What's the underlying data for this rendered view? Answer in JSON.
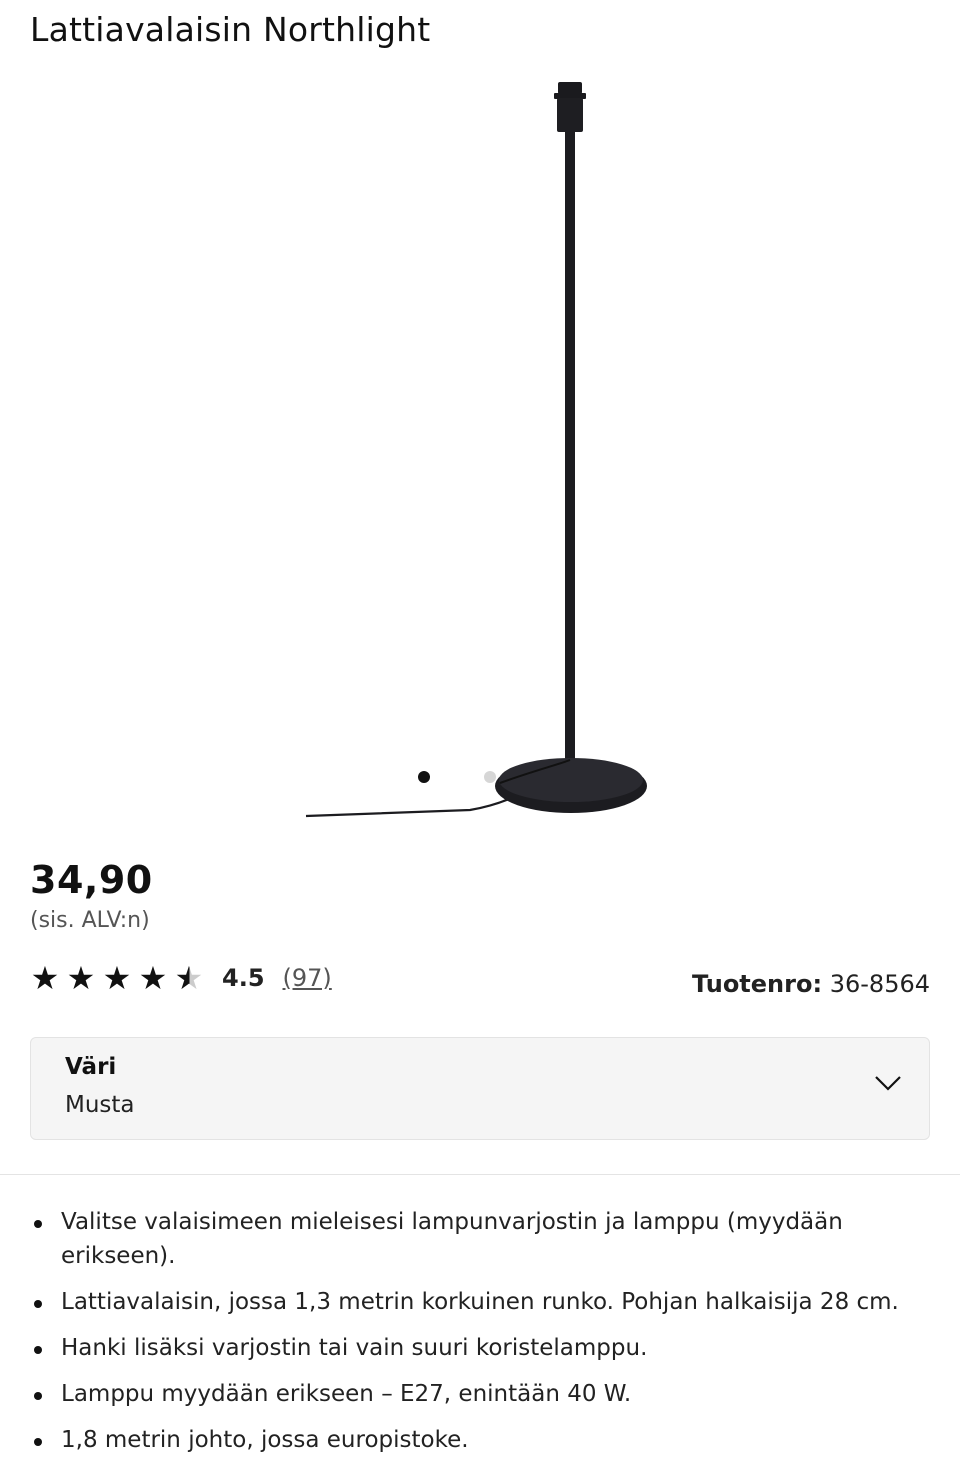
{
  "product": {
    "title": "Lattiavalaisin Northlight",
    "price": "34,90",
    "vat_note": "(sis. ALV:n)",
    "rating_value": "4.5",
    "rating_stars": 4.5,
    "review_count": "(97)",
    "article_label": "Tuotenro:",
    "article_number": "36-8564"
  },
  "gallery": {
    "image_alt": "floor-lamp-image",
    "total_images": 2,
    "active_index": 0
  },
  "color_select": {
    "label": "Väri",
    "value": "Musta"
  },
  "features": [
    "Valitse valaisimeen mieleisesi lampunvarjostin ja lamppu (myydään erikseen).",
    "Lattiavalaisin, jossa 1,3 metrin korkuinen runko. Pohjan halkaisija 28 cm.",
    "Hanki lisäksi varjostin tai vain suuri koristelamppu.",
    "Lamppu myydään erikseen – E27, enintään 40 W.",
    "1,8 metrin johto, jossa europistoke."
  ],
  "icons": {
    "star": "star-icon",
    "chevron": "chevron-down-icon"
  },
  "colors": {
    "text": "#111111",
    "muted": "#555555",
    "select_bg": "#f5f5f5"
  }
}
